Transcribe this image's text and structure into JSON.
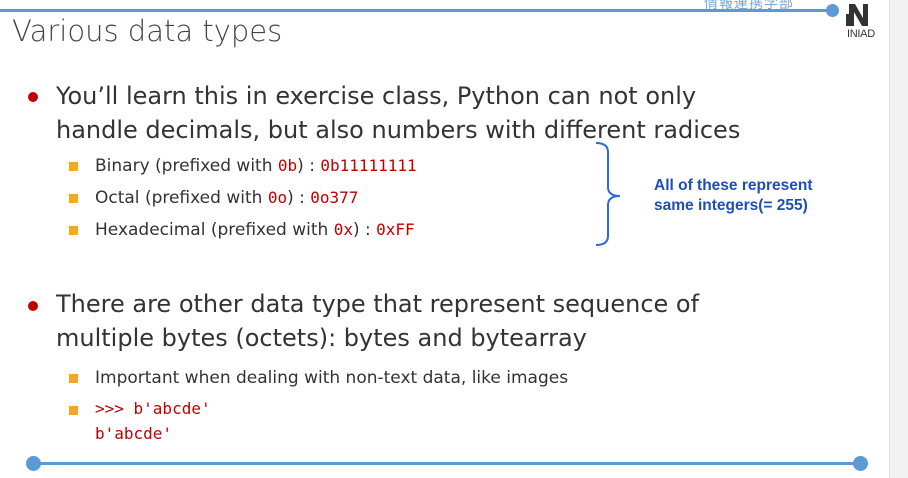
{
  "header": {
    "org_text": "情報連携学部",
    "logo_text": "INIAD"
  },
  "slide": {
    "title": "Various data types",
    "bullet1": {
      "line1": "You’ll learn this in exercise class, Python can not only",
      "line2": "handle decimals, but also numbers with different radices",
      "items": [
        {
          "pre": "Binary (prefixed with ",
          "prefix": "0b",
          "mid": ") : ",
          "value": "0b11111111"
        },
        {
          "pre": "Octal (prefixed with ",
          "prefix": "0o",
          "mid": ") : ",
          "value": "0o377"
        },
        {
          "pre": "Hexadecimal (prefixed with ",
          "prefix": "0x",
          "mid": ") : ",
          "value": "0xFF"
        }
      ],
      "note": "All of these represent\nsame integers(= 255)"
    },
    "bullet2": {
      "line1": "There are other data type that represent sequence of",
      "line2": "multiple bytes (octets): bytes and bytearray",
      "items": [
        {
          "text": "Important when dealing with non-text data, like images"
        },
        {
          "code_line1": ">>> b'abcde'",
          "code_line2": "b'abcde'"
        }
      ]
    }
  },
  "colors": {
    "accent": "#5b9bd5",
    "bullet": "#c00000",
    "square": "#f5a623",
    "code": "#c00000",
    "note": "#1f4eb4"
  }
}
